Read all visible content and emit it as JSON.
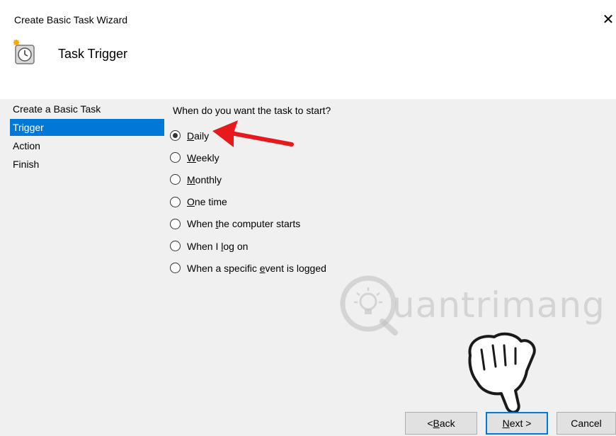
{
  "window": {
    "title": "Create Basic Task Wizard"
  },
  "header": {
    "heading": "Task Trigger",
    "icon": "task-scheduler-clock-icon"
  },
  "nav": {
    "items": [
      {
        "label": "Create a Basic Task"
      },
      {
        "label": "Trigger",
        "selected": true
      },
      {
        "label": "Action"
      },
      {
        "label": "Finish"
      }
    ]
  },
  "main": {
    "question": "When do you want the task to start?",
    "options": [
      {
        "pre": "",
        "key": "D",
        "post": "aily",
        "checked": true
      },
      {
        "pre": "",
        "key": "W",
        "post": "eekly"
      },
      {
        "pre": "",
        "key": "M",
        "post": "onthly"
      },
      {
        "pre": "",
        "key": "O",
        "post": "ne time"
      },
      {
        "pre": "When ",
        "key": "t",
        "post": "he computer starts"
      },
      {
        "pre": "When I ",
        "key": "l",
        "post": "og on"
      },
      {
        "pre": "When a specific ",
        "key": "e",
        "post": "vent is logged"
      }
    ]
  },
  "buttons": {
    "back": {
      "pre": "< ",
      "key": "B",
      "post": "ack"
    },
    "next": {
      "key": "N",
      "post": "ext >"
    },
    "cancel": "Cancel"
  },
  "overlay": {
    "watermark_text": "uantrimang",
    "annotation_arrow_color": "#e8191c",
    "accent": "#0078d7"
  }
}
